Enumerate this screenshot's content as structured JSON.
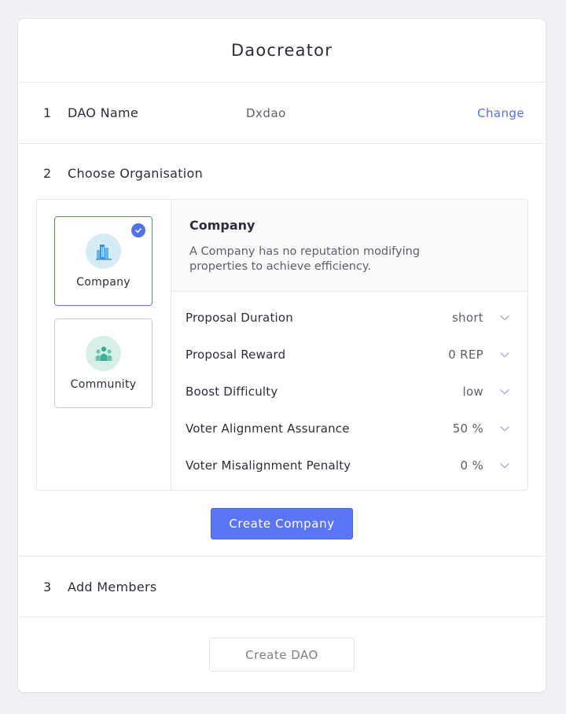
{
  "app": {
    "title": "Daocreator"
  },
  "steps": [
    {
      "number": "1",
      "label": "DAO Name",
      "value": "Dxdao",
      "action": "Change"
    },
    {
      "number": "2",
      "label": "Choose Organisation"
    },
    {
      "number": "3",
      "label": "Add Members"
    }
  ],
  "organisations": [
    {
      "name": "Company",
      "icon": "building-icon",
      "selected": true,
      "icon_bg": "#d7ebf7",
      "icon_color": "#3f8fd8"
    },
    {
      "name": "Community",
      "icon": "people-icon",
      "selected": false,
      "icon_bg": "#d8efe9",
      "icon_color": "#3fae92"
    }
  ],
  "details": {
    "title": "Company",
    "description": "A Company has no reputation modifying properties to achieve efficiency.",
    "params": [
      {
        "label": "Proposal Duration",
        "value": "short"
      },
      {
        "label": "Proposal Reward",
        "value": "0 REP"
      },
      {
        "label": "Boost Difficulty",
        "value": "low"
      },
      {
        "label": "Voter Alignment Assurance",
        "value": "50 %"
      },
      {
        "label": "Voter Misalignment Penalty",
        "value": "0 %"
      }
    ]
  },
  "buttons": {
    "create_company": "Create Company",
    "create_dao": "Create DAO"
  },
  "colors": {
    "accent": "#5272e8",
    "button": "#5b76f5",
    "selected_border": "#5b78ea"
  }
}
